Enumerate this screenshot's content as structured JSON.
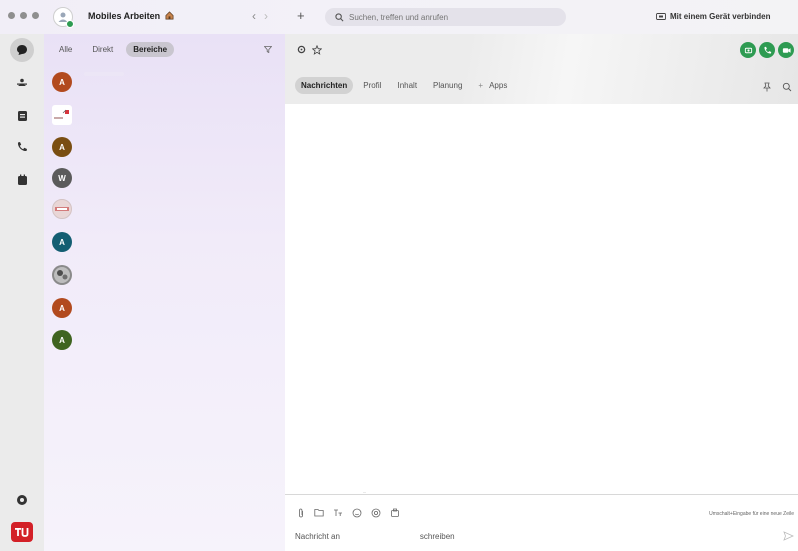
{
  "titlebar": {
    "user_name": "Mobiles Arbeiten",
    "search_placeholder": "Suchen, treffen und anrufen",
    "connect_label": "Mit einem Gerät verbinden"
  },
  "list": {
    "filters": [
      "Alle",
      "Direkt",
      "Bereiche"
    ],
    "active_filter": "Bereiche",
    "conversations": [
      {
        "initial": "A",
        "color": "#b24a1e",
        "kind": "initial"
      },
      {
        "initial": "",
        "color": "#ffffff",
        "kind": "image"
      },
      {
        "initial": "A",
        "color": "#7a4e12",
        "kind": "initial"
      },
      {
        "initial": "W",
        "color": "#5b5b5b",
        "kind": "initial"
      },
      {
        "initial": "",
        "color": "#e9d6d6",
        "kind": "image"
      },
      {
        "initial": "A",
        "color": "#135e72",
        "kind": "initial"
      },
      {
        "initial": "",
        "color": "#8a8a8a",
        "kind": "image"
      },
      {
        "initial": "A",
        "color": "#b24a1e",
        "kind": "initial"
      },
      {
        "initial": "A",
        "color": "#3f6420",
        "kind": "initial"
      }
    ]
  },
  "main": {
    "tabs": [
      "Nachrichten",
      "Profil",
      "Inhalt",
      "Planung",
      "Apps"
    ],
    "active_tab": "Nachrichten",
    "composer_hint": "Umschalt+Eingabe für eine neue Zeile",
    "composer_placeholder_part1": "Nachricht an",
    "composer_placeholder_part2": "schreiben"
  },
  "colors": {
    "accent_green": "#2e9b52",
    "logo_red": "#d32027"
  },
  "icons": {
    "rail": [
      "chat-icon",
      "teams-icon",
      "calendar-icon",
      "phone-icon",
      "files-icon",
      "help-icon"
    ],
    "header": [
      "settings-icon",
      "star-icon"
    ],
    "calls": [
      "video-call-icon",
      "audio-call-icon",
      "screen-share-icon"
    ],
    "composer": [
      "attach-icon",
      "folder-icon",
      "format-icon",
      "emoji-icon",
      "mention-icon",
      "more-icon"
    ]
  }
}
